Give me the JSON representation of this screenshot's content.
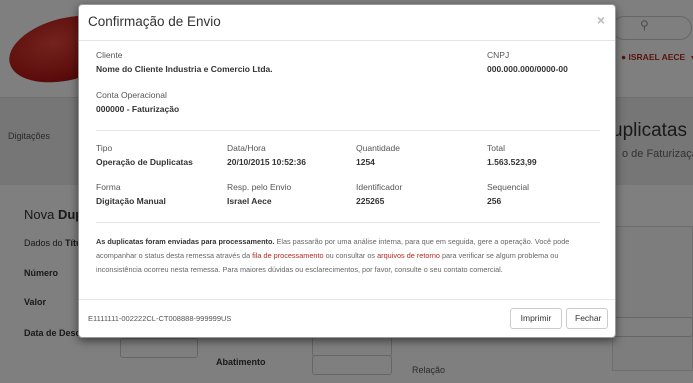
{
  "background": {
    "user_name": "ISRAEL AECE",
    "nav_item": "Digitações",
    "page_title": "uplicatas",
    "page_subtitle": "o de Faturização",
    "section_title_prefix": "Nova ",
    "section_title_bold": "Dup",
    "subsection_prefix": "Dados do ",
    "subsection_bold": "Títu",
    "labels": {
      "numero": "Número",
      "valor": "Valor",
      "data_desc": "Data de Desc",
      "abatimento": "Abatimento",
      "relacao": "Relação"
    }
  },
  "modal": {
    "title": "Confirmação de Envio",
    "close_symbol": "×",
    "cliente": {
      "label": "Cliente",
      "value": "Nome do Cliente Industria e Comercio Ltda."
    },
    "cnpj": {
      "label": "CNPJ",
      "value": "000.000.000/0000-00"
    },
    "conta": {
      "label": "Conta Operacional",
      "value": "000000 - Faturização"
    },
    "tipo": {
      "label": "Tipo",
      "value": "Operação de Duplicatas"
    },
    "data_hora": {
      "label": "Data/Hora",
      "value": "20/10/2015 10:52:36"
    },
    "quantidade": {
      "label": "Quantidade",
      "value": "1254"
    },
    "total": {
      "label": "Total",
      "value": "1.563.523,99"
    },
    "forma": {
      "label": "Forma",
      "value": "Digitação Manual"
    },
    "resp": {
      "label": "Resp. pelo Envio",
      "value": "Israel Aece"
    },
    "identificador": {
      "label": "Identificador",
      "value": "225265"
    },
    "sequencial": {
      "label": "Sequencial",
      "value": "256"
    },
    "message": {
      "bold": "As duplicatas foram enviadas para processamento.",
      "part1": " Elas passarão por uma análise interna, para que em seguida, gere a operação. Você pode acompanhar o status desta remessa através da ",
      "link1": "fila de processamento",
      "part2": " ou consultar os ",
      "link2": "arquivos de retorno",
      "part3": " para verificar se algum problema ou inconsistência ocorreu nesta remessa. Para maiores dúvidas ou esclarecimentos, por favor, consulte o seu contato comercial."
    },
    "protocol": "E1111111-002222CL-CT008888-999999US",
    "print_label": "Imprimir",
    "close_label": "Fechar"
  },
  "colors": {
    "accent": "#b52a22",
    "overlay": "rgba(0,0,0,0.5)"
  }
}
